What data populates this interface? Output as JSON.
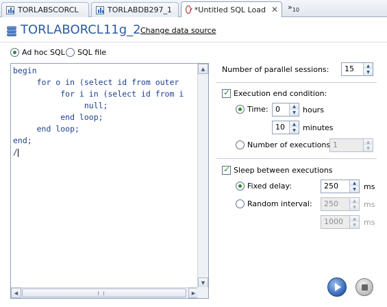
{
  "tabs": [
    {
      "label": "TORLABSCORCL",
      "icon": "chart-icon",
      "active": false
    },
    {
      "label": "TORLABDB297_1",
      "icon": "chart-icon",
      "active": false
    },
    {
      "label": "*Untitled SQL Load",
      "icon": "gauge-icon",
      "active": true
    }
  ],
  "tab_overflow": {
    "symbol": "»",
    "count": "10"
  },
  "header": {
    "title": "TORLABORCL11g_2",
    "change_link": "Change data source"
  },
  "source_mode": {
    "adhoc_label": "Ad hoc SQL",
    "file_label": "SQL file",
    "selected": "adhoc"
  },
  "editor": {
    "lines": [
      "begin",
      "     for o in (select id from outer",
      "          for i in (select id from i",
      "               null;",
      "          end loop;",
      "     end loop;",
      "end;",
      "/"
    ]
  },
  "parallel": {
    "label": "Number of parallel sessions:",
    "value": "15"
  },
  "exec_end": {
    "label": "Execution end condition:",
    "checked": true,
    "time_label": "Time:",
    "hours_value": "0",
    "hours_unit": "hours",
    "minutes_value": "10",
    "minutes_unit": "minutes",
    "count_label": "Number of executions:",
    "count_value": "1",
    "selected": "time"
  },
  "sleep": {
    "label": "Sleep between executions",
    "checked": true,
    "fixed_label": "Fixed delay:",
    "fixed_value": "250",
    "fixed_unit": "ms",
    "random_label": "Random interval:",
    "random_min": "250",
    "random_min_unit": "ms",
    "random_max": "1000",
    "random_max_unit": "ms",
    "selected": "fixed"
  },
  "colors": {
    "title": "#2a5aa5",
    "code": "#1b3f8c",
    "radio_check": "#2e8b2e",
    "run_button": "#2f63b5"
  }
}
